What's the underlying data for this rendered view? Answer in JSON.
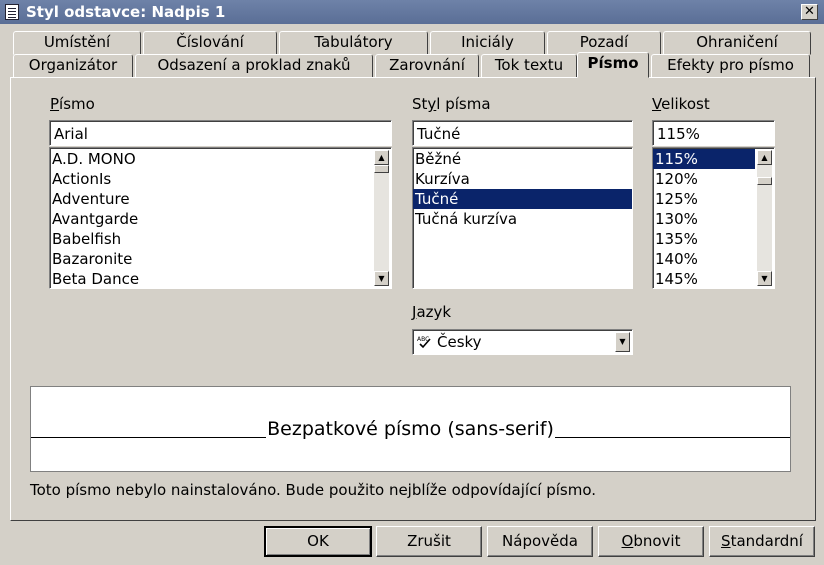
{
  "window": {
    "title": "Styl odstavce: Nadpis 1"
  },
  "tabs_back": [
    {
      "label": "Umístění"
    },
    {
      "label": "Číslování"
    },
    {
      "label": "Tabulátory"
    },
    {
      "label": "Iniciály"
    },
    {
      "label": "Pozadí"
    },
    {
      "label": "Ohraničení"
    }
  ],
  "tabs_front": [
    {
      "label": "Organizátor"
    },
    {
      "label": "Odsazení a proklad znaků"
    },
    {
      "label": "Zarovnání"
    },
    {
      "label": "Tok textu"
    },
    {
      "label": "Písmo"
    },
    {
      "label": "Efekty pro písmo"
    }
  ],
  "font": {
    "label": "Písmo",
    "label_key": "P",
    "label_rest": "ísmo",
    "value": "Arial",
    "items": [
      "A.D. MONO",
      "ActionIs",
      "Adventure",
      "Avantgarde",
      "Babelfish",
      "Bazaronite",
      "Beta Dance"
    ]
  },
  "style": {
    "label_pre": "St",
    "label_key": "y",
    "label_rest": "l písma",
    "value": "Tučné",
    "items": [
      "Běžné",
      "Kurzíva",
      "Tučné",
      "Tučná kurzíva"
    ],
    "selected": "Tučné"
  },
  "size": {
    "label_key": "V",
    "label_rest": "elikost",
    "value": "115%",
    "items": [
      "115%",
      "120%",
      "125%",
      "130%",
      "135%",
      "140%",
      "145%"
    ],
    "selected": "115%"
  },
  "language": {
    "label_key": "J",
    "label_rest": "azyk",
    "value": "Česky",
    "icon": "spellcheck-icon"
  },
  "preview": {
    "text": "Bezpatkové písmo (sans-serif)"
  },
  "warning": "Toto písmo nebylo nainstalováno. Bude použito nejblíže odpovídající písmo.",
  "buttons": {
    "ok": "OK",
    "cancel": "Zrušit",
    "help": "Nápověda",
    "reset_key": "O",
    "reset_rest": "bnovit",
    "standard_key": "S",
    "standard_rest": "tandardní"
  },
  "colors": {
    "selection": "#0a246a",
    "titlebar": "#5a6e96",
    "face": "#d4d0c8"
  }
}
